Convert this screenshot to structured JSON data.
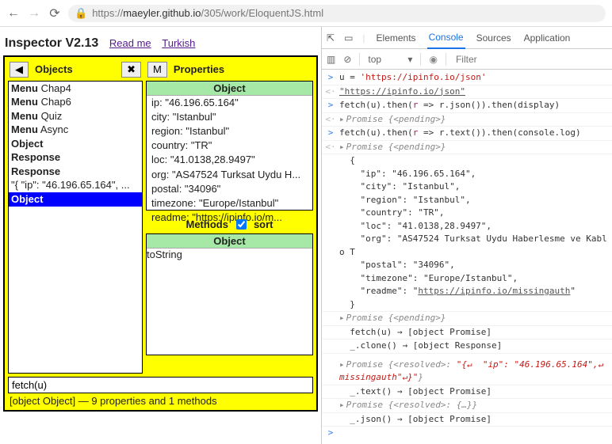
{
  "browser": {
    "back": "←",
    "forward": "→",
    "reload": "⟳",
    "lock": "🔒",
    "url_dim1": "https://",
    "url_host": "maeyler.github.io",
    "url_dim2": "/305/work/EloquentJS.html"
  },
  "header": {
    "title": "Inspector V2.13",
    "links": {
      "readme": "Read me",
      "turkish": "Turkish"
    }
  },
  "inspector": {
    "nav_prev": "◀",
    "objects_label": "Objects",
    "close_label": "✖",
    "m_btn": "M",
    "properties_label": "Properties",
    "methods_label": "Methods",
    "sort_label": "sort",
    "object_head": "Object",
    "objects": [
      {
        "b": "Menu",
        "t": " Chap4"
      },
      {
        "b": "Menu",
        "t": " Chap6"
      },
      {
        "b": "Menu",
        "t": " Quiz"
      },
      {
        "b": "Menu",
        "t": " Async"
      },
      {
        "b": "Object",
        "t": ""
      },
      {
        "b": "Response",
        "t": ""
      },
      {
        "b": "Response",
        "t": ""
      },
      {
        "b": "",
        "t": "\"{ \"ip\": \"46.196.65.164\", ..."
      },
      {
        "b": "Object",
        "t": "",
        "sel": true
      }
    ],
    "props": [
      "ip: \"46.196.65.164\"",
      "city: \"Istanbul\"",
      "region: \"Istanbul\"",
      "country: \"TR\"",
      "loc: \"41.0138,28.9497\"",
      "org: \"AS47524 Turksat Uydu H...",
      "postal: \"34096\"",
      "timezone: \"Europe/Istanbul\"",
      "readme: \"https://ipinfo.io/m..."
    ],
    "methods": [
      "toString"
    ],
    "expr_value": "fetch(u)",
    "status": "[object Object] — 9 properties and 1 methods"
  },
  "devtools": {
    "tabs": {
      "elements": "Elements",
      "console": "Console",
      "sources": "Sources",
      "application": "Application"
    },
    "sub": {
      "top": "top",
      "filter_ph": "Filter"
    },
    "lines": [
      {
        "gut": ">",
        "gutcls": "in",
        "html": "u = <span class=\"tok-str\">'https://ipinfo.io/json'</span>"
      },
      {
        "gut": "<·",
        "gutcls": "out",
        "html": "<span class=\"tok-link\">\"https://ipinfo.io/json\"</span>"
      },
      {
        "gut": ">",
        "gutcls": "in",
        "html": "fetch(u).then(<span class=\"tok-kw\">r</span> =&gt; r.json()).then(display)"
      },
      {
        "gut": "<·",
        "gutcls": "out",
        "html": "<span class=\"caret\">▸</span><span class=\"tok-it\">Promise {&lt;pending&gt;}</span>"
      },
      {
        "gut": ">",
        "gutcls": "in",
        "html": "fetch(u).then(<span class=\"tok-kw\">r</span> =&gt; r.text()).then(console.log)"
      },
      {
        "gut": "<·",
        "gutcls": "out",
        "html": "<span class=\"caret\">▸</span><span class=\"tok-it\">Promise {&lt;pending&gt;}</span>"
      },
      {
        "gut": "",
        "gutcls": "",
        "html": "&nbsp;&nbsp;{<br>&nbsp;&nbsp;&nbsp;&nbsp;\"ip\": \"46.196.65.164\",<br>&nbsp;&nbsp;&nbsp;&nbsp;\"city\": \"Istanbul\",<br>&nbsp;&nbsp;&nbsp;&nbsp;\"region\": \"Istanbul\",<br>&nbsp;&nbsp;&nbsp;&nbsp;\"country\": \"TR\",<br>&nbsp;&nbsp;&nbsp;&nbsp;\"loc\": \"41.0138,28.9497\",<br>&nbsp;&nbsp;&nbsp;&nbsp;\"org\": \"AS47524 Turksat Uydu Haberlesme ve Kablo T<br>&nbsp;&nbsp;&nbsp;&nbsp;\"postal\": \"34096\",<br>&nbsp;&nbsp;&nbsp;&nbsp;\"timezone\": \"Europe/Istanbul\",<br>&nbsp;&nbsp;&nbsp;&nbsp;\"readme\": \"<span class=\"tok-link\">https://ipinfo.io/missingauth</span>\"<br>&nbsp;&nbsp;}"
      },
      {
        "gut": "",
        "gutcls": "",
        "html": "<span class=\"caret\">▸</span><span class=\"tok-it\">Promise {&lt;pending&gt;}</span>"
      },
      {
        "gut": "",
        "gutcls": "",
        "html": "&nbsp;&nbsp;fetch(u) → [object Promise]"
      },
      {
        "gut": "",
        "gutcls": "",
        "html": "&nbsp;&nbsp;_.clone() → [object Response]"
      },
      {
        "gut": "",
        "gutcls": "",
        "cls": "blank",
        "html": ""
      },
      {
        "gut": "",
        "gutcls": "",
        "html": "<span class=\"caret\">▸</span><span class=\"tok-it\">Promise {&lt;resolved&gt;: </span><span class=\"tok-res\">\"{↵&nbsp;&nbsp;\"ip\": \"46.196.65.164\",↵<br>missingauth\"↵}\"</span><span class=\"tok-it\">}</span>"
      },
      {
        "gut": "",
        "gutcls": "",
        "html": "&nbsp;&nbsp;_.text() → [object Promise]"
      },
      {
        "gut": "",
        "gutcls": "",
        "html": "<span class=\"caret\">▸</span><span class=\"tok-it\">Promise {&lt;resolved&gt;: {…}}</span>"
      },
      {
        "gut": "",
        "gutcls": "",
        "html": "&nbsp;&nbsp;_.json() → [object Promise]"
      }
    ]
  }
}
